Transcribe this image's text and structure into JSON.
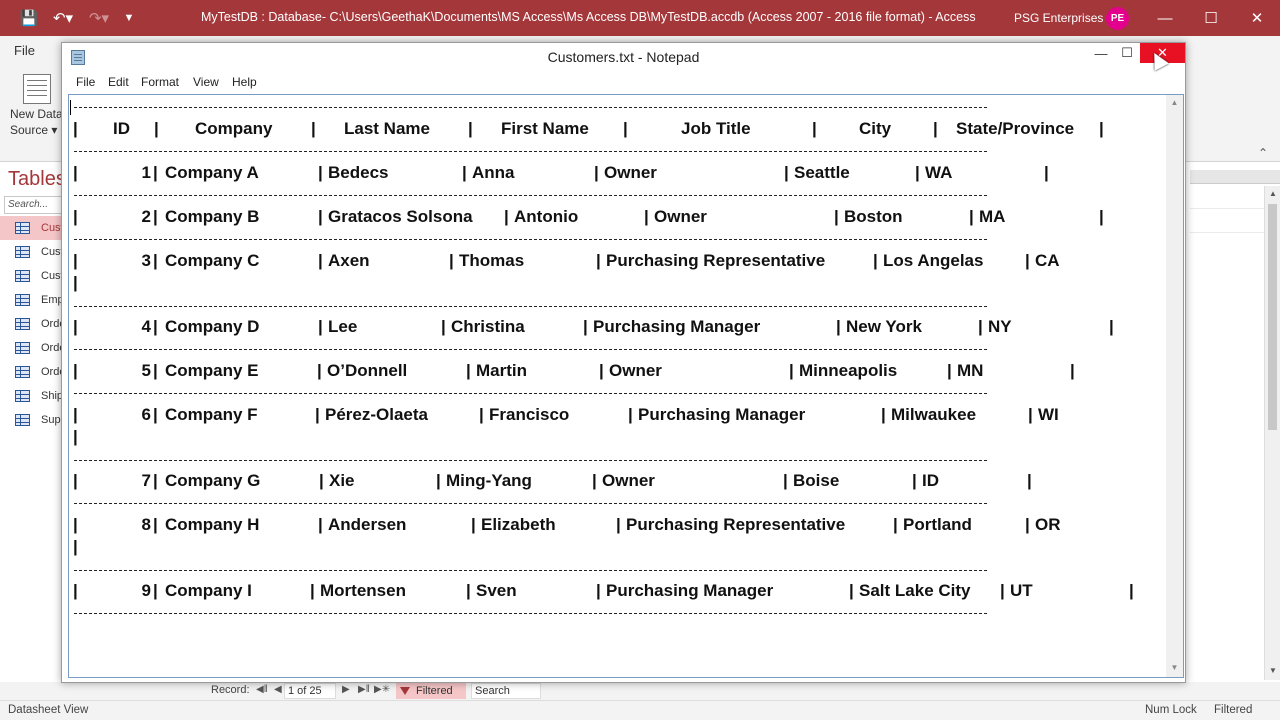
{
  "access": {
    "title": "MyTestDB : Database- C:\\Users\\GeethaK\\Documents\\MS Access\\Ms Access DB\\MyTestDB.accdb (Access 2007 - 2016 file format)  -  Access",
    "user": "PSG Enterprises",
    "avatar_initials": "PE",
    "file_tab": "File",
    "new_data_source": [
      "New Data",
      "Source ▾"
    ],
    "nav_heading": "Tables",
    "nav_search_placeholder": "Search...",
    "nav_items": [
      "Customers",
      "Customers",
      "Customers",
      "Employees",
      "Orders",
      "Orders",
      "Orders",
      "Shippers",
      "Suppliers"
    ],
    "record_label": "Record:",
    "record_position": "1 of 25",
    "filtered_label": "Filtered",
    "search_label": "Search",
    "status_left": "Datasheet View",
    "status_numlock": "Num Lock",
    "status_filtered": "Filtered",
    "accent": "#a4373a"
  },
  "notepad": {
    "title": "Customers.txt - Notepad",
    "menus": [
      "File",
      "Edit",
      "Format",
      "View",
      "Help"
    ],
    "columns": [
      "ID",
      "Company",
      "Last Name",
      "First Name",
      "Job Title",
      "City",
      "State/Province"
    ],
    "rows": [
      {
        "id": "1",
        "company": "Company A",
        "last": "Bedecs",
        "first": "Anna",
        "job": "Owner",
        "city": "Seattle",
        "state": "WA"
      },
      {
        "id": "2",
        "company": "Company B",
        "last": "Gratacos Solsona",
        "first": "Antonio",
        "job": "Owner",
        "city": "Boston",
        "state": "MA"
      },
      {
        "id": "3",
        "company": "Company C",
        "last": "Axen",
        "first": "Thomas",
        "job": "Purchasing Representative",
        "city": "Los Angelas",
        "state": "CA"
      },
      {
        "id": "4",
        "company": "Company D",
        "last": "Lee",
        "first": "Christina",
        "job": "Purchasing Manager",
        "city": "New York",
        "state": "NY"
      },
      {
        "id": "5",
        "company": "Company E",
        "last": "O’Donnell",
        "first": "Martin",
        "job": "Owner",
        "city": "Minneapolis",
        "state": "MN"
      },
      {
        "id": "6",
        "company": "Company F",
        "last": "Pérez-Olaeta",
        "first": "Francisco",
        "job": "Purchasing Manager",
        "city": "Milwaukee",
        "state": "WI"
      },
      {
        "id": "7",
        "company": "Company G",
        "last": "Xie",
        "first": "Ming-Yang",
        "job": "Owner",
        "city": "Boise",
        "state": "ID"
      },
      {
        "id": "8",
        "company": "Company H",
        "last": "Andersen",
        "first": "Elizabeth",
        "job": "Purchasing Representative",
        "city": "Portland",
        "state": "OR"
      },
      {
        "id": "9",
        "company": "Company I",
        "last": "Mortensen",
        "first": "Sven",
        "job": "Purchasing Manager",
        "city": "Salt Lake City",
        "state": "UT"
      }
    ]
  }
}
